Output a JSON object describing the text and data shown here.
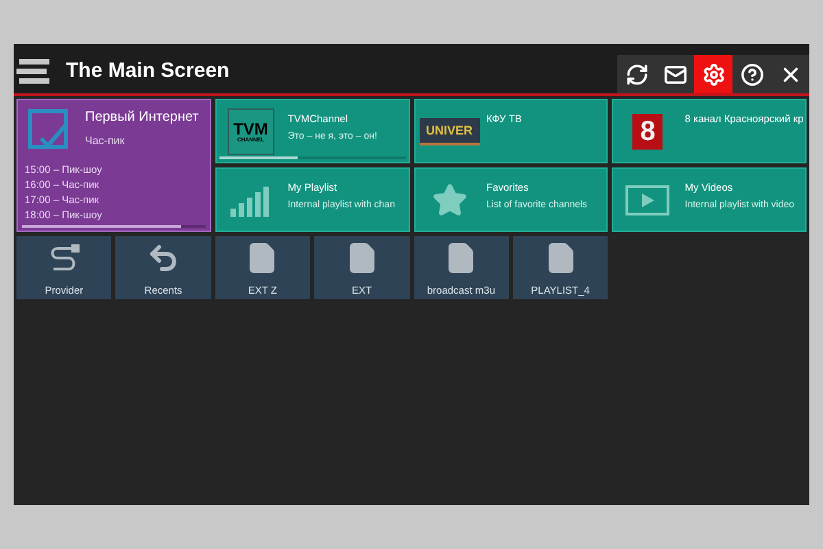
{
  "header": {
    "title": "The Main Screen"
  },
  "toolbar": [
    {
      "kind": "refresh",
      "selected": false
    },
    {
      "kind": "mail",
      "selected": false
    },
    {
      "kind": "settings",
      "selected": true
    },
    {
      "kind": "help",
      "selected": false
    },
    {
      "kind": "close",
      "selected": false
    }
  ],
  "featured": {
    "title": "Первый Интернет",
    "subtitle": "Час-пик",
    "schedule": [
      "15:00 – Пик-шоу",
      "16:00 – Час-пик",
      "17:00 – Час-пик",
      "18:00 – Пик-шоу"
    ],
    "level": 0.87,
    "selected": true
  },
  "tiles": [
    {
      "kind": "tvm",
      "logo_text": [
        "TVM",
        "CHANNEL"
      ],
      "title": "TVMChannel",
      "subtitle": "Это – не я, это – он!",
      "level": 0.42,
      "selected": false
    },
    {
      "kind": "univer",
      "logo_text": [
        "UNIVER"
      ],
      "title": "КФУ ТВ",
      "selected": false
    },
    {
      "kind": "eight",
      "logo_text": [
        "8"
      ],
      "title": "8 канал Красноярский кр",
      "selected": false
    },
    {
      "kind": "playlist",
      "title": "My Playlist",
      "subtitle": "Internal playlist with chan",
      "selected": false
    },
    {
      "kind": "favorites",
      "title": "Favorites",
      "subtitle": "List of favorite channels",
      "selected": false
    },
    {
      "kind": "videos",
      "title": "My Videos",
      "subtitle": "Internal playlist with video",
      "selected": false
    }
  ],
  "shortcuts": [
    {
      "kind": "provider",
      "label": "Provider"
    },
    {
      "kind": "recents",
      "label": "Recents"
    },
    {
      "kind": "file",
      "label": "EXT Z"
    },
    {
      "kind": "file",
      "label": "EXT"
    },
    {
      "kind": "file",
      "label": "broadcast m3u"
    },
    {
      "kind": "file",
      "label": "PLAYLIST_4"
    }
  ]
}
